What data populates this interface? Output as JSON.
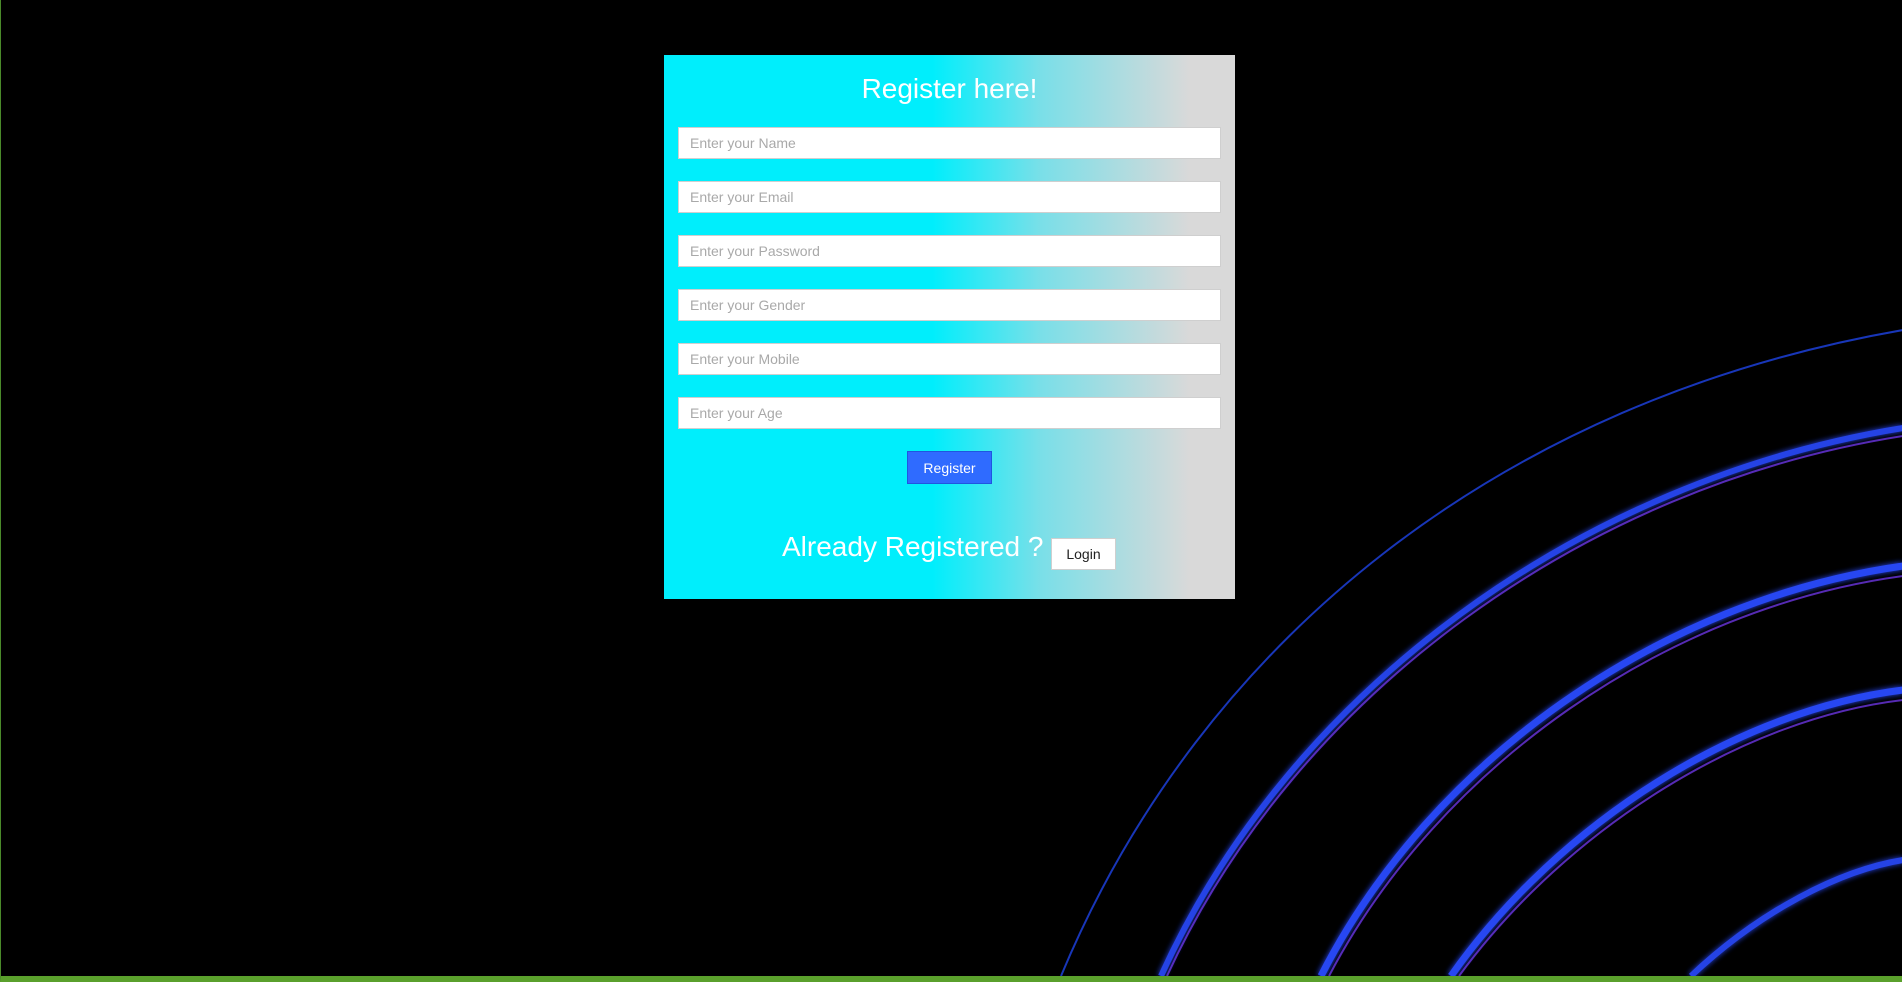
{
  "colors": {
    "page_background": "#000000",
    "panel_gradient_start": "#00eefc",
    "panel_gradient_end": "#d9d9d9",
    "register_button": "#2f6bff",
    "bottom_bar": "#5aa02c",
    "arc_blue": "#2a4bff",
    "arc_violet": "#7a3cff"
  },
  "form": {
    "title": "Register here!",
    "fields": [
      {
        "placeholder": "Enter your Name",
        "value": ""
      },
      {
        "placeholder": "Enter your Email",
        "value": ""
      },
      {
        "placeholder": "Enter your Password",
        "value": ""
      },
      {
        "placeholder": "Enter your Gender",
        "value": ""
      },
      {
        "placeholder": "Enter your Mobile",
        "value": ""
      },
      {
        "placeholder": "Enter your Age",
        "value": ""
      }
    ],
    "register_label": "Register",
    "already_text": "Already Registered ?",
    "login_label": "Login"
  }
}
